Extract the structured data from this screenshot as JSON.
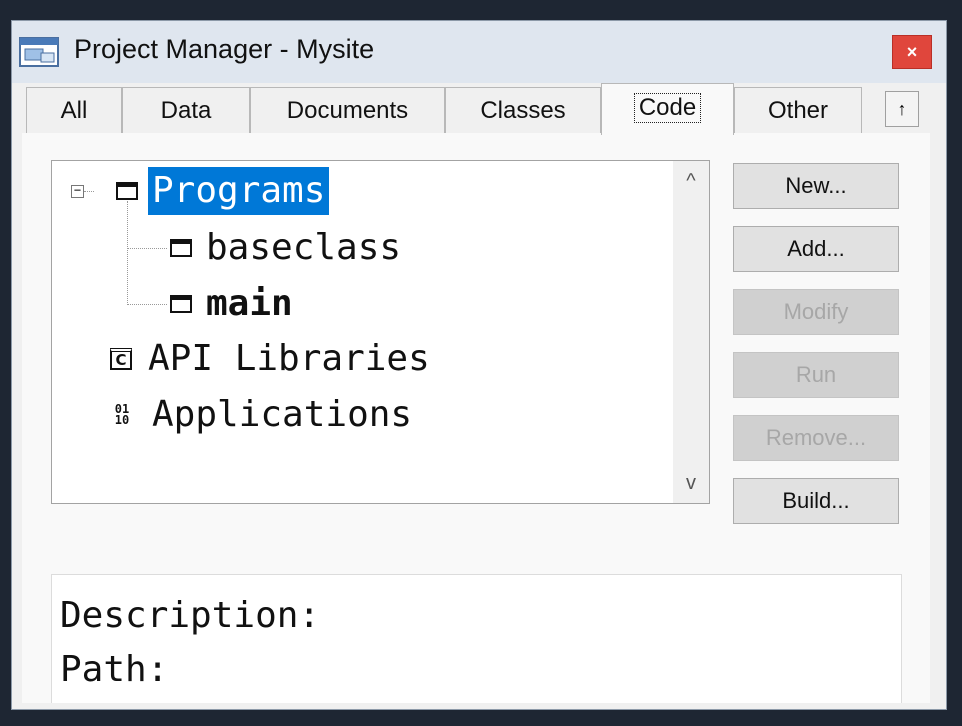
{
  "window": {
    "title": "Project Manager - Mysite",
    "close_label": "×"
  },
  "tabs": [
    {
      "label": "All"
    },
    {
      "label": "Data"
    },
    {
      "label": "Documents"
    },
    {
      "label": "Classes"
    },
    {
      "label": "Code",
      "active": true
    },
    {
      "label": "Other"
    }
  ],
  "tab_scroll_label": "↑",
  "tree": {
    "items": [
      {
        "label": "Programs",
        "icon": "program-window-icon",
        "selected": true,
        "expanded": true
      },
      {
        "label": "baseclass",
        "icon": "program-window-icon"
      },
      {
        "label": "main",
        "icon": "program-window-icon",
        "bold": true
      },
      {
        "label": "API Libraries",
        "icon": "api-library-icon",
        "icon_text": "C"
      },
      {
        "label": "Applications",
        "icon": "binary-app-icon",
        "icon_text": "01 10"
      }
    ],
    "scroll_up": "^",
    "scroll_down": "v"
  },
  "buttons": [
    {
      "label": "New...",
      "enabled": true
    },
    {
      "label": "Add...",
      "enabled": true
    },
    {
      "label": "Modify",
      "enabled": false
    },
    {
      "label": "Run",
      "enabled": false
    },
    {
      "label": "Remove...",
      "enabled": false
    },
    {
      "label": "Build...",
      "enabled": true
    }
  ],
  "details": {
    "description_label": "Description:",
    "path_label": "Path:"
  },
  "colors": {
    "selection": "#0078d7",
    "close": "#e0463c",
    "background": "#1e2633"
  }
}
